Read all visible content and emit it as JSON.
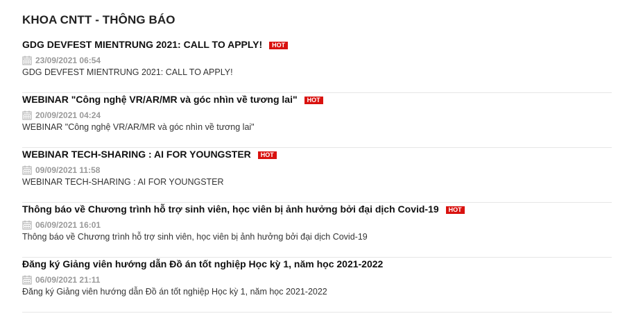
{
  "section": {
    "title": "KHOA CNTT - THÔNG BÁO"
  },
  "icons": {
    "date": "calendar-icon"
  },
  "colors": {
    "hot_badge": "#d9120f",
    "date_text": "#9a9a9a"
  },
  "news": [
    {
      "title": "GDG DEVFEST MIENTRUNG 2021: CALL TO APPLY!",
      "hot": "HOT",
      "date": "23/09/2021 06:54",
      "summary": "GDG DEVFEST MIENTRUNG 2021: CALL TO APPLY!"
    },
    {
      "title": "WEBINAR \"Công nghệ VR/AR/MR và góc nhìn về tương lai\"",
      "hot": "HOT",
      "date": "20/09/2021 04:24",
      "summary": "WEBINAR \"Công nghệ VR/AR/MR và góc nhìn về tương lai\""
    },
    {
      "title": "WEBINAR TECH-SHARING : AI FOR YOUNGSTER",
      "hot": "HOT",
      "date": "09/09/2021 11:58",
      "summary": "WEBINAR TECH-SHARING : AI FOR YOUNGSTER"
    },
    {
      "title": "Thông báo về Chương trình hỗ trợ sinh viên, học viên bị ảnh hưởng bởi đại dịch Covid-19",
      "hot": "HOT",
      "date": "06/09/2021 16:01",
      "summary": "Thông báo về Chương trình hỗ trợ sinh viên, học viên bị ảnh hưởng bởi đại dịch Covid-19"
    },
    {
      "title": "Đăng ký Giảng viên hướng dẫn Đồ án tốt nghiệp Học kỳ 1, năm học 2021-2022",
      "hot": "",
      "date": "06/09/2021 21:11",
      "summary": "Đăng ký Giảng viên hướng dẫn Đồ án tốt nghiệp Học kỳ 1, năm học 2021-2022"
    }
  ]
}
